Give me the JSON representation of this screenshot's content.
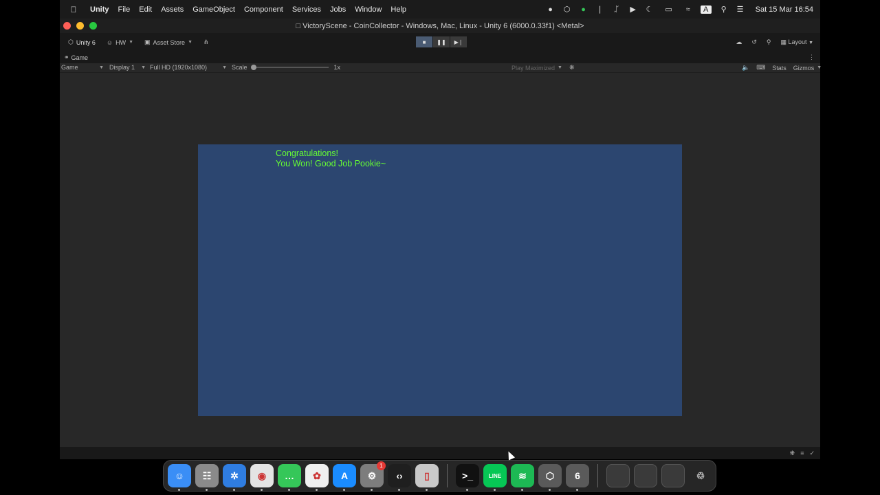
{
  "menubar": {
    "app_name": "Unity",
    "items": [
      "File",
      "Edit",
      "Assets",
      "GameObject",
      "Component",
      "Services",
      "Jobs",
      "Window",
      "Help"
    ],
    "clock": "Sat 15 Mar  16:54",
    "input_source": "A"
  },
  "window": {
    "title": "VictoryScene - CoinCollector - Windows, Mac, Linux - Unity 6 (6000.0.33f1) <Metal>"
  },
  "toolbar": {
    "account_label": "Unity 6",
    "hw_label": "HW",
    "asset_store_label": "Asset Store",
    "layout_label": "Layout"
  },
  "tab": {
    "label": "Game"
  },
  "game_toolbar": {
    "mode_label": "Game",
    "display_label": "Display 1",
    "resolution_label": "Full HD (1920x1080)",
    "scale_label": "Scale",
    "scale_value": "1x",
    "scale_level": 0,
    "play_mode_label": "Play Maximized",
    "stats_label": "Stats",
    "gizmos_label": "Gizmos"
  },
  "game": {
    "line1": "Congratulations!",
    "line2": "You Won!  Good Job Pookie~",
    "background_color": "#2c4670",
    "text_color": "#66ff33"
  },
  "dock": {
    "apps": [
      {
        "name": "Finder",
        "icon": "finder-icon",
        "color": "#3a8ef6"
      },
      {
        "name": "Launchpad",
        "icon": "launchpad-icon",
        "color": "#8a8a8a"
      },
      {
        "name": "Safari",
        "icon": "safari-icon",
        "color": "#2f7de1"
      },
      {
        "name": "Chrome",
        "icon": "chrome-icon",
        "color": "#e4e4e4"
      },
      {
        "name": "Messages",
        "icon": "messages-icon",
        "color": "#35c759"
      },
      {
        "name": "Photos",
        "icon": "photos-icon",
        "color": "#f0f0f0"
      },
      {
        "name": "App Store",
        "icon": "app-store-icon",
        "color": "#1a8cff"
      },
      {
        "name": "System Settings",
        "icon": "settings-icon",
        "color": "#7d7d7d",
        "badge": "1"
      },
      {
        "name": "Visual Studio Code",
        "icon": "vscode-icon",
        "color": "#1f1f1f"
      },
      {
        "name": "iPhone Mirroring",
        "icon": "iphone-mirroring-icon",
        "color": "#c9c9c9"
      },
      {
        "name": "Terminal",
        "icon": "terminal-icon",
        "color": "#111111"
      },
      {
        "name": "LINE",
        "icon": "line-icon",
        "color": "#06c755"
      },
      {
        "name": "Spotify",
        "icon": "spotify-icon",
        "color": "#1db954"
      },
      {
        "name": "Unity Hub",
        "icon": "unity-hub-icon",
        "color": "#5a5a5a"
      },
      {
        "name": "Unity 6",
        "icon": "unity-6-icon",
        "color": "#5a5a5a"
      }
    ]
  }
}
